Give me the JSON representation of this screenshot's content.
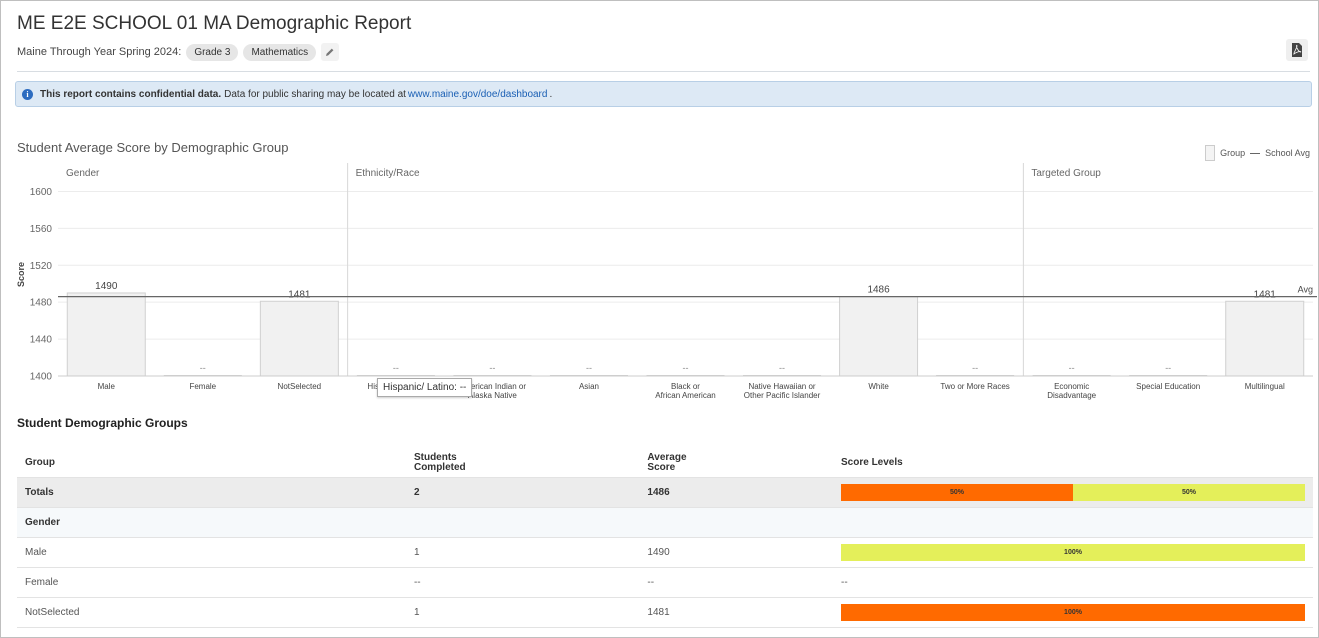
{
  "header": {
    "title": "ME E2E SCHOOL 01 MA Demographic Report",
    "subtitle_prefix": "Maine Through Year Spring 2024:",
    "chips": [
      "Grade 3",
      "Mathematics"
    ]
  },
  "alert": {
    "bold": "This report contains confidential data.",
    "text": "Data for public sharing may be located at",
    "link": "www.maine.gov/doe/dashboard",
    "suffix": "."
  },
  "chart": {
    "title": "Student Average Score by Demographic Group",
    "legend_group": "Group",
    "legend_avg": "School Avg",
    "avg_label": "Avg",
    "tooltip": "Hispanic/ Latino: --"
  },
  "chart_data": {
    "type": "bar",
    "title": "Student Average Score by Demographic Group",
    "ylabel": "Score",
    "ylim": [
      1400,
      1620
    ],
    "yticks": [
      1400,
      1440,
      1480,
      1520,
      1560,
      1600
    ],
    "school_avg": 1486,
    "groups": [
      {
        "name": "Gender",
        "categories": [
          "Male",
          "Female",
          "NotSelected"
        ],
        "values": [
          1490,
          null,
          1481
        ]
      },
      {
        "name": "Ethnicity/Race",
        "categories": [
          "Hispanic/ Latino",
          "American Indian or Alaska Native",
          "Asian",
          "Black or African American",
          "Native Hawaiian or Other Pacific Islander",
          "White",
          "Two or More Races"
        ],
        "values": [
          null,
          null,
          null,
          null,
          null,
          1486,
          null
        ]
      },
      {
        "name": "Targeted Group",
        "categories": [
          "Economic Disadvantage",
          "Special Education",
          "Multilingual"
        ],
        "values": [
          null,
          null,
          1481
        ]
      }
    ],
    "empty_label": "--",
    "grid": true,
    "legend": "top-right"
  },
  "table": {
    "section_title": "Student Demographic Groups",
    "headers": {
      "group": "Group",
      "students_1": "Students",
      "students_2": "Completed",
      "avg_1": "Average",
      "avg_2": "Score",
      "levels": "Score Levels"
    },
    "rows": [
      {
        "kind": "totals",
        "group": "Totals",
        "students": "2",
        "avg": "1486",
        "levels": [
          {
            "pct": 50,
            "label": "50%",
            "color": "#ff6a00"
          },
          {
            "pct": 50,
            "label": "50%",
            "color": "#e4ef5a"
          }
        ]
      },
      {
        "kind": "header",
        "group": "Gender"
      },
      {
        "kind": "row",
        "group": "Male",
        "students": "1",
        "avg": "1490",
        "levels": [
          {
            "pct": 100,
            "label": "100%",
            "color": "#e4ef5a"
          }
        ]
      },
      {
        "kind": "row",
        "group": "Female",
        "students": "--",
        "avg": "--",
        "levels_text": "--"
      },
      {
        "kind": "row",
        "group": "NotSelected",
        "students": "1",
        "avg": "1481",
        "levels": [
          {
            "pct": 100,
            "label": "100%",
            "color": "#ff6a00"
          }
        ]
      }
    ]
  }
}
